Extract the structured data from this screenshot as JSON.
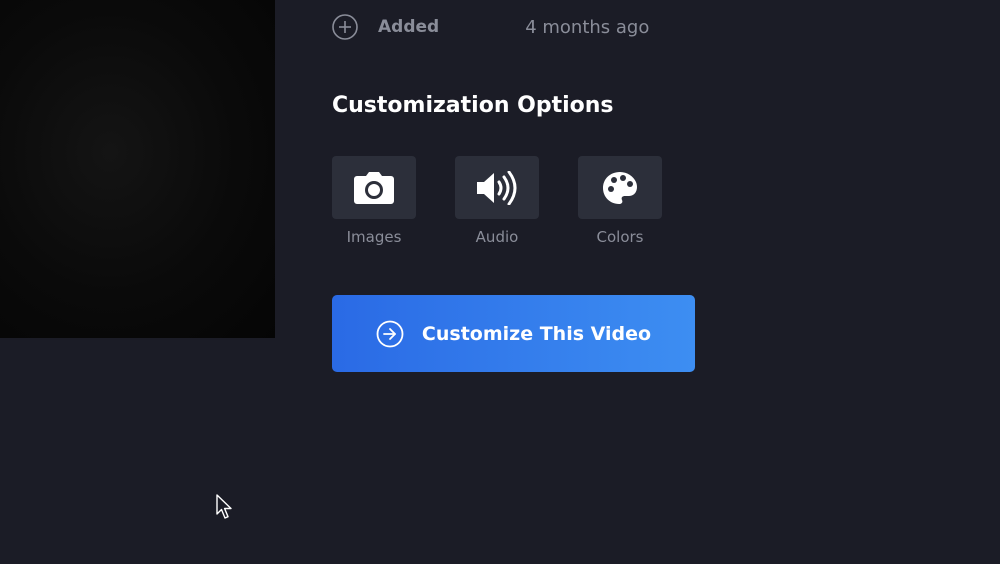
{
  "status": {
    "added_label": "Added",
    "added_time": "4 months ago",
    "icon": "plus-circle-icon"
  },
  "customization": {
    "title": "Customization Options",
    "options": [
      {
        "label": "Images",
        "icon": "camera-icon"
      },
      {
        "label": "Audio",
        "icon": "speaker-icon"
      },
      {
        "label": "Colors",
        "icon": "palette-icon"
      }
    ]
  },
  "cta": {
    "label": "Customize This Video",
    "icon": "arrow-circle-right-icon",
    "color_start": "#2a6ae5",
    "color_end": "#3d8ef2"
  },
  "colors": {
    "background": "#1b1c26",
    "tile": "#2c2f3a",
    "muted_text": "#8a8d99"
  }
}
